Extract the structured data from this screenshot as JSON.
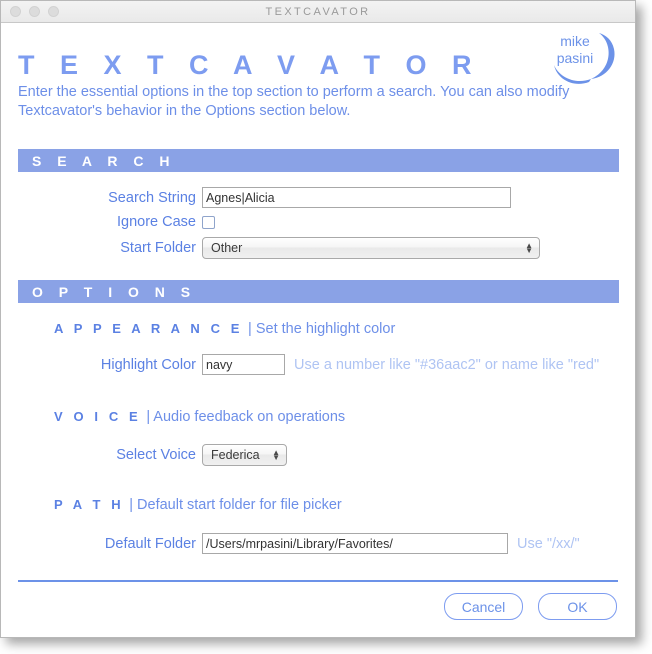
{
  "window": {
    "titlebar_title": "TEXTCAVATOR",
    "traffic_lights": [
      "close-button",
      "minimize-button",
      "zoom-button"
    ]
  },
  "header": {
    "app_title": "T E X T C A V A T O R",
    "intro": "Enter the essential options in the top section to perform a search. You can also modify Textcavator's behavior in the Options section below.",
    "logo": {
      "line1": "mike",
      "line2": "pasini"
    }
  },
  "search_section": {
    "bar_label": "S E A R C H",
    "search_string": {
      "label": "Search String",
      "value": "Agnes|Alicia",
      "placeholder": ""
    },
    "ignore_case": {
      "label": "Ignore Case",
      "checked": false
    },
    "start_folder": {
      "label": "Start Folder",
      "value": "Other"
    }
  },
  "options_section": {
    "bar_label": "O P T I O N S",
    "appearance": {
      "name": "A P P E A R A N C E",
      "desc": "| Set the highlight color",
      "highlight_color": {
        "label": "Highlight Color",
        "value": "navy",
        "hint": "Use a number like \"#36aac2\" or name like \"red\""
      }
    },
    "voice": {
      "name": "V O I C E",
      "desc": "| Audio feedback on operations",
      "select_voice": {
        "label": "Select Voice",
        "value": "Federica"
      }
    },
    "path": {
      "name": "P A T H",
      "desc": "| Default start folder for file picker",
      "default_folder": {
        "label": "Default Folder",
        "value": "/Users/mrpasini/Library/Favorites/",
        "hint": "Use \"/xx/\""
      }
    }
  },
  "footer": {
    "cancel_label": "Cancel",
    "ok_label": "OK"
  },
  "colors": {
    "header_bar": "#8aa2e6",
    "title_blue": "#7d9cf0",
    "label_blue": "#5b81e3",
    "hint_blue": "#afc4f3",
    "divider_blue": "#6c92e8"
  }
}
